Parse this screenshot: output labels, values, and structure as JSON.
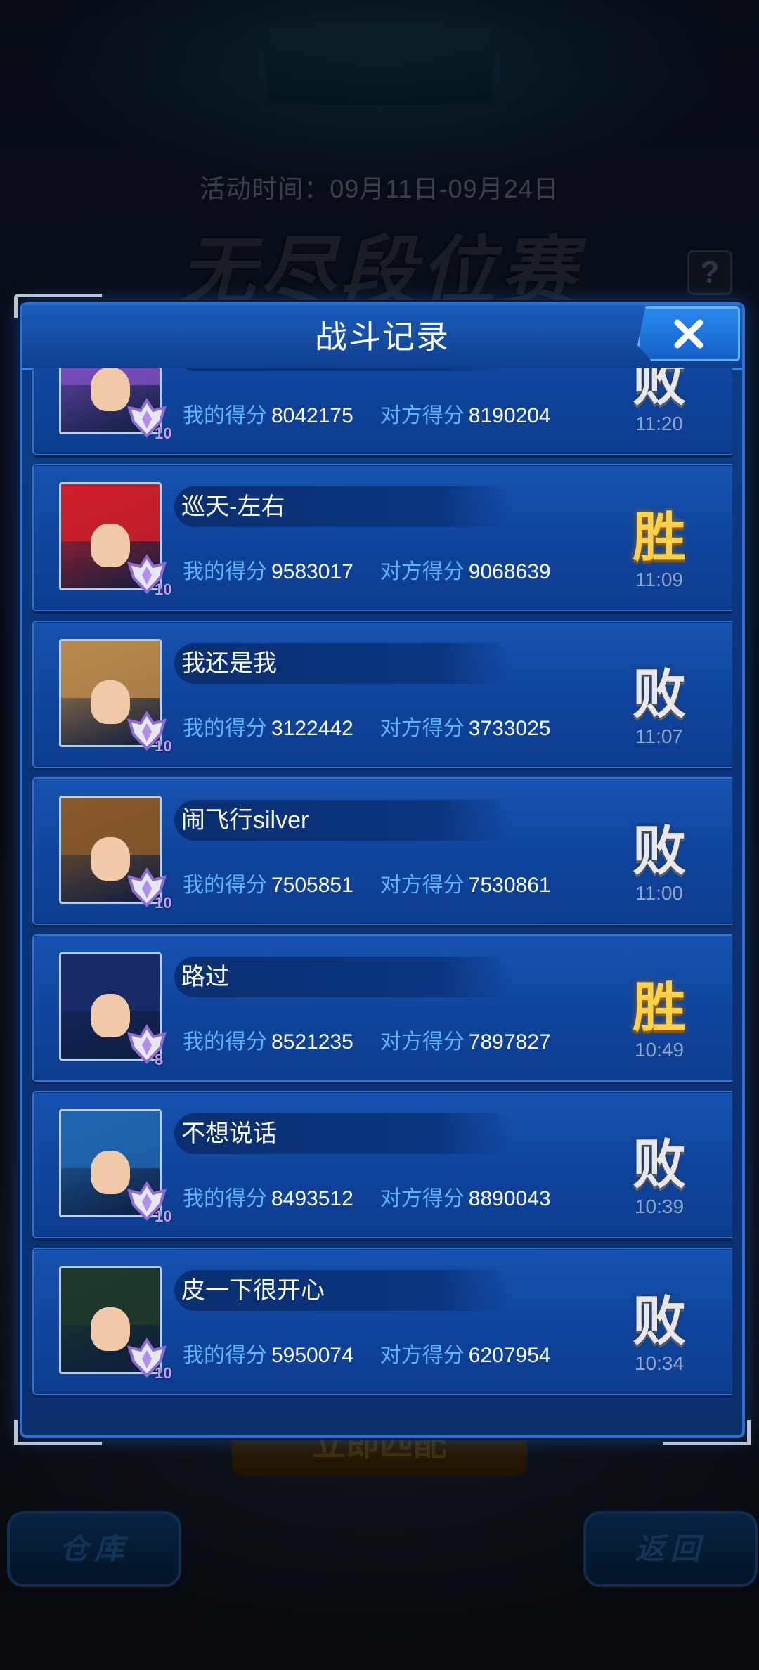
{
  "background": {
    "event_time": "活动时间：09月11日-09月24日",
    "event_title": "无尽段位赛",
    "help": "?",
    "start_button": "立即匹配",
    "left_button": "仓库",
    "right_button": "返回"
  },
  "modal": {
    "title": "战斗记录",
    "close_icon": "close-x-icon",
    "my_score_label": "我的得分",
    "opp_score_label": "对方得分",
    "records": [
      {
        "name": "",
        "my_score": "8042175",
        "opp_score": "8190204",
        "result": "败",
        "time": "11:20",
        "rank": "10",
        "avatar_color": "#7a4fbf"
      },
      {
        "name": "巡天-左右",
        "my_score": "9583017",
        "opp_score": "9068639",
        "result": "胜",
        "time": "11:09",
        "rank": "10",
        "avatar_color": "#d0202a"
      },
      {
        "name": "我还是我",
        "my_score": "3122442",
        "opp_score": "3733025",
        "result": "败",
        "time": "11:07",
        "rank": "10",
        "avatar_color": "#b98a4a"
      },
      {
        "name": "闹飞行silver",
        "my_score": "7505851",
        "opp_score": "7530861",
        "result": "败",
        "time": "11:00",
        "rank": "10",
        "avatar_color": "#8a5a2a"
      },
      {
        "name": "路过",
        "my_score": "8521235",
        "opp_score": "7897827",
        "result": "胜",
        "time": "10:49",
        "rank": "8",
        "avatar_color": "#1a2a6a"
      },
      {
        "name": "不想说话",
        "my_score": "8493512",
        "opp_score": "8890043",
        "result": "败",
        "time": "10:39",
        "rank": "10",
        "avatar_color": "#1f66b0"
      },
      {
        "name": "皮一下很开心",
        "my_score": "5950074",
        "opp_score": "6207954",
        "result": "败",
        "time": "10:34",
        "rank": "10",
        "avatar_color": "#1e3a2a"
      }
    ]
  }
}
